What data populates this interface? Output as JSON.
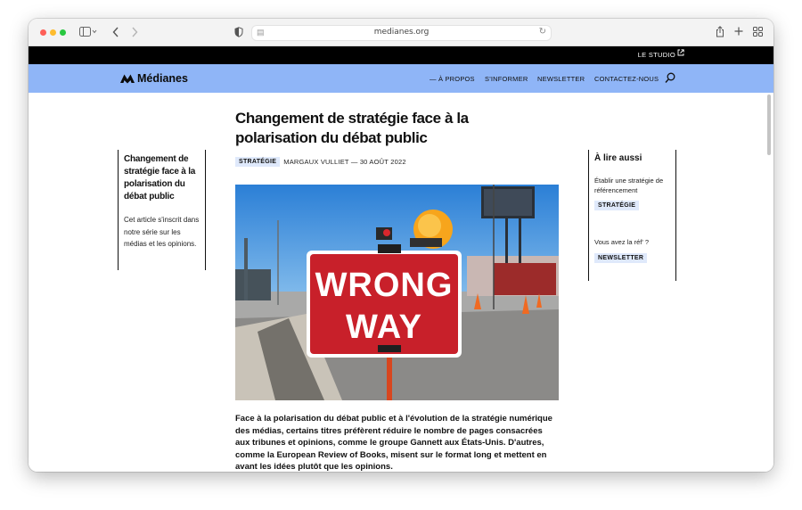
{
  "browser": {
    "url": "medianes.org",
    "icons": [
      "sidebar-toggle-icon",
      "back-icon",
      "forward-icon",
      "shield-icon",
      "share-icon",
      "new-tab-icon",
      "tab-overview-icon"
    ]
  },
  "topbar": {
    "studio": "LE STUDIO"
  },
  "nav": {
    "brand": "Médianes",
    "items": [
      "— À PROPOS",
      "S'INFORMER",
      "NEWSLETTER",
      "CONTACTEZ-NOUS"
    ]
  },
  "article": {
    "title": "Changement de stratégie face à la polarisation du débat public",
    "tag": "STRATÉGIE",
    "byline": "MARGAUX VULLIET — 30 AOÛT 2022",
    "image_alt": "WRONG WAY",
    "sign_line1": "WRONG",
    "sign_line2": "WAY",
    "lede": "Face à la polarisation du débat public et à l'évolution de la stratégie numérique des médias, certains titres préfèrent réduire le nombre de pages consacrées aux tribunes et opinions, comme le groupe Gannett aux États-Unis. D'autres, comme la European Review of Books, misent sur le format long et mettent en avant les idées plutôt que les opinions."
  },
  "left_sidebar": {
    "title": "Changement de stratégie face à la polarisation du débat public",
    "text": "Cet article s'inscrit dans notre série sur les médias et les opinions."
  },
  "right_sidebar": {
    "title": "À lire aussi",
    "items": [
      {
        "text": "Établir une stratégie de référencement",
        "tag": "STRATÉGIE"
      },
      {
        "text": "Vous avez la réf' ?",
        "tag": "NEWSLETTER"
      }
    ]
  },
  "colors": {
    "nav_bg": "#8fb5f7",
    "tag_bg": "#dfe9fb",
    "topbar": "#000000",
    "sign_red": "#c8202a"
  }
}
